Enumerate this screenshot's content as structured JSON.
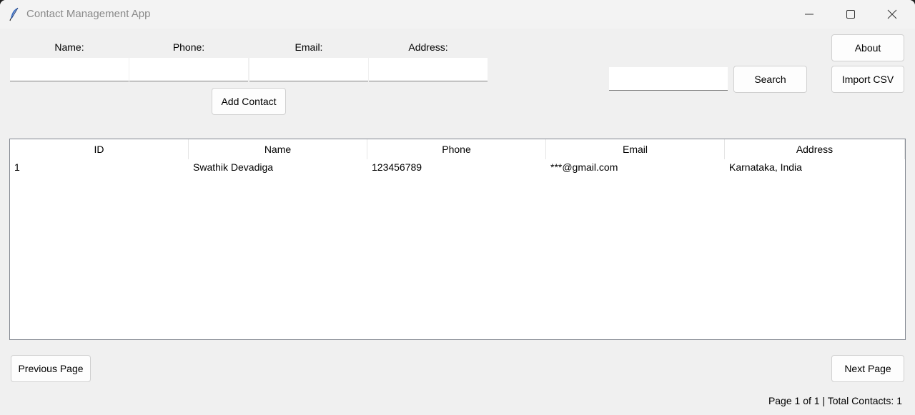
{
  "window": {
    "title": "Contact Management App",
    "icon": "feather-icon",
    "controls": [
      "minimize-icon",
      "maximize-icon",
      "close-icon"
    ]
  },
  "form": {
    "name_label": "Name:",
    "phone_label": "Phone:",
    "email_label": "Email:",
    "address_label": "Address:",
    "name_value": "",
    "phone_value": "",
    "email_value": "",
    "address_value": "",
    "add_button": "Add Contact"
  },
  "search": {
    "value": "",
    "button": "Search"
  },
  "actions": {
    "about": "About",
    "import_csv": "Import CSV"
  },
  "table": {
    "columns": [
      "ID",
      "Name",
      "Phone",
      "Email",
      "Address"
    ],
    "rows": [
      [
        "1",
        "Swathik Devadiga",
        "123456789",
        "***@gmail.com",
        "Karnataka, India"
      ]
    ]
  },
  "pagination": {
    "previous": "Previous Page",
    "next": "Next Page",
    "status": "Page 1 of 1 | Total Contacts: 1"
  }
}
